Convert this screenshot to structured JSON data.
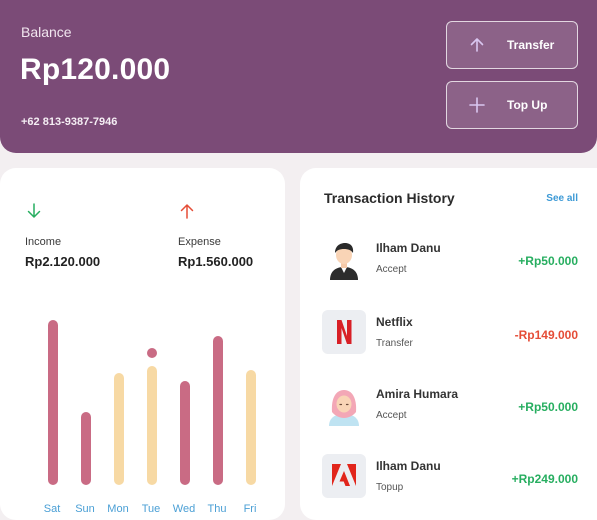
{
  "balance": {
    "label": "Balance",
    "amount": "Rp120.000",
    "phone": "+62 813-9387-7946",
    "actions": [
      {
        "label": "Transfer",
        "icon": "arrow-up-icon"
      },
      {
        "label": "Top Up",
        "icon": "plus-icon"
      }
    ]
  },
  "stats": {
    "income": {
      "label": "Income",
      "value": "Rp2.120.000",
      "icon": "arrow-down-icon",
      "color": "#27ae60"
    },
    "expense": {
      "label": "Expense",
      "value": "Rp1.560.000",
      "icon": "arrow-up-icon",
      "color": "#e54d37"
    }
  },
  "chart_data": {
    "type": "bar",
    "categories": [
      "Sat",
      "Sun",
      "Mon",
      "Tue",
      "Wed",
      "Thu",
      "Fri"
    ],
    "values": [
      1.0,
      0.44,
      0.68,
      0.72,
      0.63,
      0.9,
      0.7
    ],
    "colors": [
      "#c96b84",
      "#c96b84",
      "#f7d9a4",
      "#f7d9a4",
      "#c96b84",
      "#c96b84",
      "#f7d9a4"
    ],
    "highlight_dot": {
      "category": "Tue",
      "value": 0.8,
      "color": "#c96b84"
    }
  },
  "history": {
    "title": "Transaction History",
    "see_all": "See all",
    "items": [
      {
        "name": "Ilham Danu",
        "status": "Accept",
        "amount": "+Rp50.000",
        "type": "positive",
        "avatar": "man-avatar-icon"
      },
      {
        "name": "Netflix",
        "status": "Transfer",
        "amount": "-Rp149.000",
        "type": "negative",
        "avatar": "netflix-logo-icon"
      },
      {
        "name": "Amira Humara",
        "status": "Accept",
        "amount": "+Rp50.000",
        "type": "positive",
        "avatar": "woman-hijab-avatar-icon"
      },
      {
        "name": "Ilham Danu",
        "status": "Topup",
        "amount": "+Rp249.000",
        "type": "positive",
        "avatar": "adobe-logo-icon"
      }
    ]
  }
}
